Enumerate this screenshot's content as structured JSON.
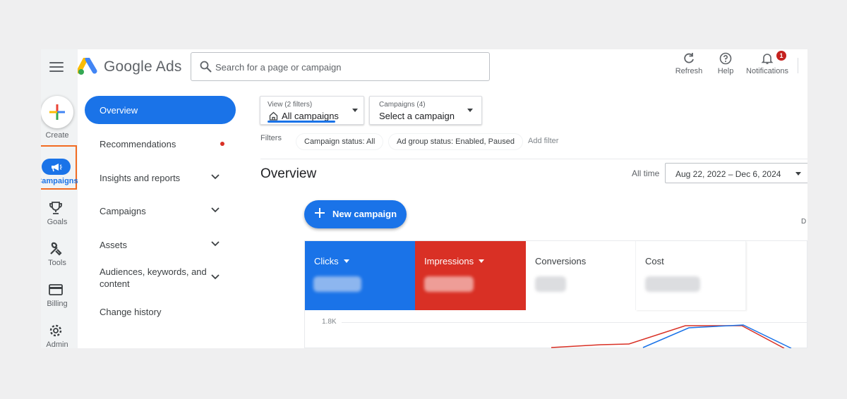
{
  "header": {
    "menu_icon": "hamburger-menu-icon",
    "logo_text": "Google Ads",
    "search_placeholder": "Search for a page or campaign",
    "refresh_label": "Refresh",
    "help_label": "Help",
    "notifications_label": "Notifications",
    "notifications_badge": "1"
  },
  "rail": {
    "create_label": "Create",
    "campaigns_label": "Campaigns",
    "goals_label": "Goals",
    "tools_label": "Tools",
    "billing_label": "Billing",
    "admin_label": "Admin"
  },
  "nav": {
    "items": [
      {
        "label": "Overview",
        "active": true
      },
      {
        "label": "Recommendations"
      },
      {
        "label": "Insights and reports"
      },
      {
        "label": "Campaigns"
      },
      {
        "label": "Assets"
      },
      {
        "label": "Audiences, keywords, and content"
      },
      {
        "label": "Change history"
      }
    ]
  },
  "filters": {
    "view_small": "View (2 filters)",
    "view_value": "All campaigns",
    "campaigns_small": "Campaigns (4)",
    "campaigns_value": "Select a campaign",
    "filters_label": "Filters",
    "chips": [
      "Campaign status: All",
      "Ad group status: Enabled, Paused"
    ],
    "add_filter": "Add filter"
  },
  "main": {
    "title": "Overview",
    "all_time": "All time",
    "date_range": "Aug 22, 2022 – Dec 6, 2024",
    "new_campaign": "New campaign",
    "edge_text": "D"
  },
  "scorecards": [
    {
      "label": "Clicks",
      "color": "#1a73e8"
    },
    {
      "label": "Impressions",
      "color": "#d93025"
    },
    {
      "label": "Conversions"
    },
    {
      "label": "Cost"
    }
  ],
  "chart": {
    "y_tick": "1.8K"
  },
  "colors": {
    "accent": "#1a73e8",
    "red": "#d93025",
    "highlight_box": "#f26b21"
  }
}
